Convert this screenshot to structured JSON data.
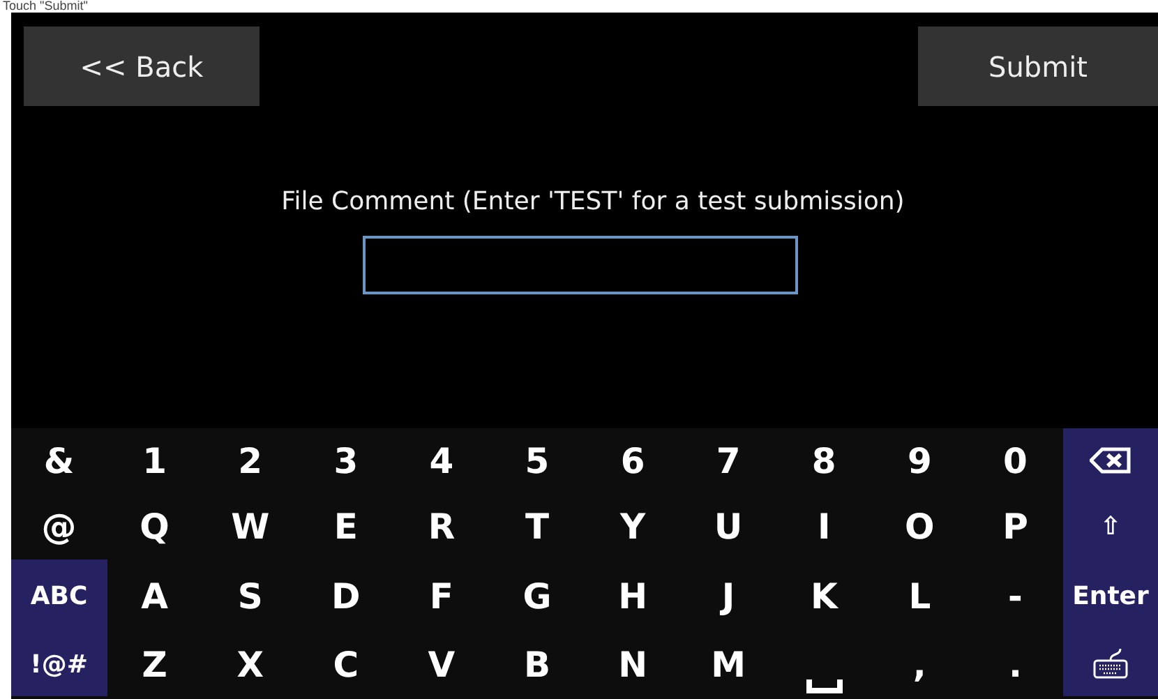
{
  "caption": "Touch \"Submit\"",
  "back_button": {
    "label": "<< Back"
  },
  "submit_button": {
    "label": "Submit"
  },
  "prompt": "File Comment (Enter 'TEST' for a test submission)",
  "keyboard": {
    "rows": [
      [
        {
          "kind": "char",
          "label": "&"
        },
        {
          "kind": "char",
          "label": "1"
        },
        {
          "kind": "char",
          "label": "2"
        },
        {
          "kind": "char",
          "label": "3"
        },
        {
          "kind": "char",
          "label": "4"
        },
        {
          "kind": "char",
          "label": "5"
        },
        {
          "kind": "char",
          "label": "6"
        },
        {
          "kind": "char",
          "label": "7"
        },
        {
          "kind": "char",
          "label": "8"
        },
        {
          "kind": "char",
          "label": "9"
        },
        {
          "kind": "char",
          "label": "0"
        },
        {
          "kind": "backspace"
        }
      ],
      [
        {
          "kind": "char",
          "label": "@"
        },
        {
          "kind": "char",
          "label": "Q"
        },
        {
          "kind": "char",
          "label": "W"
        },
        {
          "kind": "char",
          "label": "E"
        },
        {
          "kind": "char",
          "label": "R"
        },
        {
          "kind": "char",
          "label": "T"
        },
        {
          "kind": "char",
          "label": "Y"
        },
        {
          "kind": "char",
          "label": "U"
        },
        {
          "kind": "char",
          "label": "I"
        },
        {
          "kind": "char",
          "label": "O"
        },
        {
          "kind": "char",
          "label": "P"
        },
        {
          "kind": "special",
          "label": "⇧"
        }
      ],
      [
        {
          "kind": "special",
          "label": "ABC"
        },
        {
          "kind": "char",
          "label": "A"
        },
        {
          "kind": "char",
          "label": "S"
        },
        {
          "kind": "char",
          "label": "D"
        },
        {
          "kind": "char",
          "label": "F"
        },
        {
          "kind": "char",
          "label": "G"
        },
        {
          "kind": "char",
          "label": "H"
        },
        {
          "kind": "char",
          "label": "J"
        },
        {
          "kind": "char",
          "label": "K"
        },
        {
          "kind": "char",
          "label": "L"
        },
        {
          "kind": "char",
          "label": "-"
        },
        {
          "kind": "special",
          "label": "Enter"
        }
      ],
      [
        {
          "kind": "special",
          "label": "!@#"
        },
        {
          "kind": "char",
          "label": "Z"
        },
        {
          "kind": "char",
          "label": "X"
        },
        {
          "kind": "char",
          "label": "C"
        },
        {
          "kind": "char",
          "label": "V"
        },
        {
          "kind": "char",
          "label": "B"
        },
        {
          "kind": "char",
          "label": "N"
        },
        {
          "kind": "char",
          "label": "M"
        },
        {
          "kind": "space"
        },
        {
          "kind": "char",
          "label": ","
        },
        {
          "kind": "char",
          "label": "."
        },
        {
          "kind": "hide"
        }
      ]
    ]
  }
}
